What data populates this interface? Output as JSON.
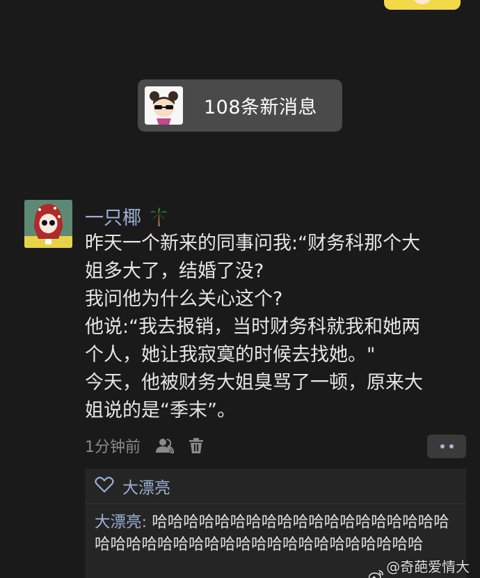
{
  "new_messages": {
    "label": "108条新消息"
  },
  "comment": {
    "author": "一只椰",
    "lines": [
      "昨天一个新来的同事问我:“财务科那个大",
      "姐多大了，结婚了没?",
      "我问他为什么关心这个?",
      "他说:“我去报销，当时财务科就我和她两",
      "个人，她让我寂寞的时候去找她。\"",
      "今天，他被财务大姐臭骂了一顿，原来大",
      "姐说的是“季末”。"
    ],
    "time": "1分钟前"
  },
  "likes": {
    "names": "大漂亮"
  },
  "reply": {
    "author": "大漂亮:",
    "text": " 哈哈哈哈哈哈哈哈哈哈哈哈哈哈哈哈哈哈哈哈哈哈哈哈哈哈哈哈哈哈哈哈哈哈哈哈哈哈哈哈"
  },
  "watermark": {
    "text": "@奇葩爱情大赏"
  },
  "icons": {
    "palm": "palm-tree-icon",
    "user": "user-icon",
    "trash": "trash-icon",
    "heart": "heart-icon",
    "more": "more-icon",
    "weibo": "weibo-icon"
  },
  "colors": {
    "background": "#1a1a1a",
    "name_blue": "#9ab0d4",
    "pill_bg": "#4a4a4a"
  }
}
